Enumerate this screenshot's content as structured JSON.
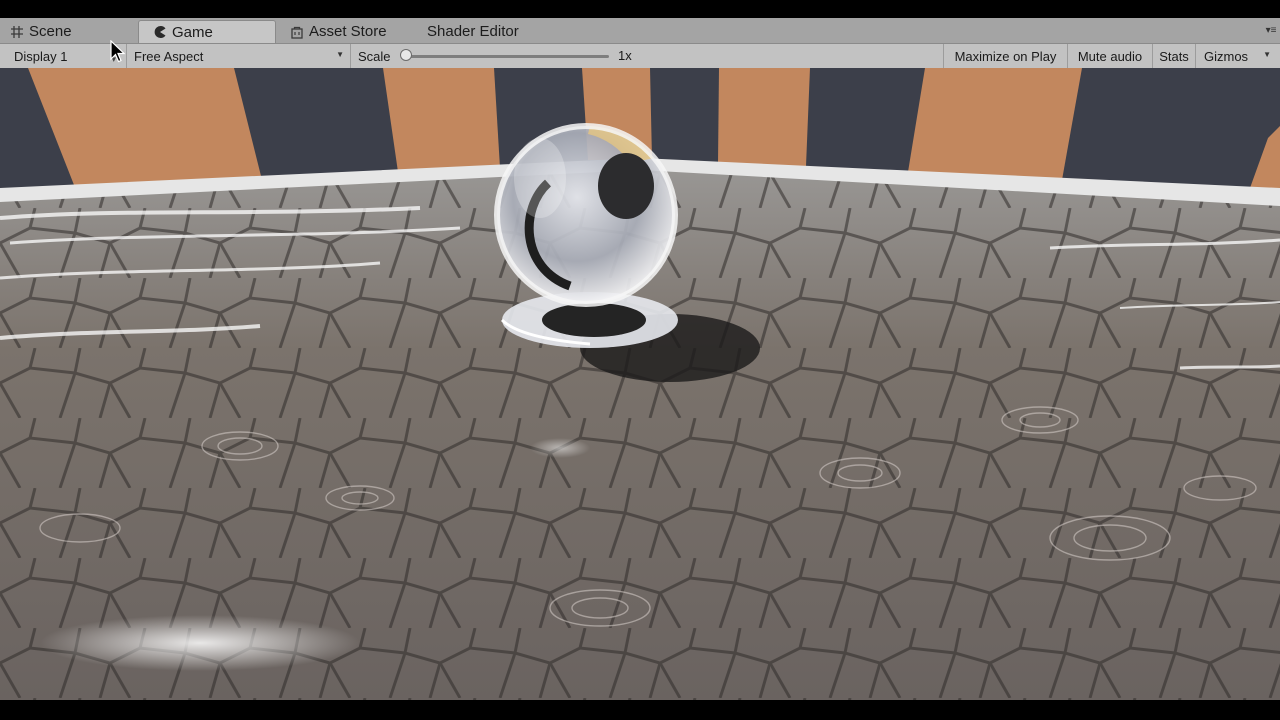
{
  "tabs": [
    {
      "label": "Scene",
      "icon": "grid-icon",
      "active": false
    },
    {
      "label": "Game",
      "icon": "pacman-icon",
      "active": true
    },
    {
      "label": "Asset Store",
      "icon": "store-icon",
      "active": false
    },
    {
      "label": "Shader Editor",
      "icon": "",
      "active": false
    }
  ],
  "toolbar": {
    "display": "Display 1",
    "aspect": "Free Aspect",
    "scale_label": "Scale",
    "scale_value": "1x",
    "scale_fraction": 0.0,
    "maximize": "Maximize on Play",
    "mute": "Mute audio",
    "stats": "Stats",
    "gizmos": "Gizmos"
  },
  "colors": {
    "wall_stripe_orange": "#c2875e",
    "wall_stripe_dark": "#3c3f4a",
    "floor_stone": "#6e6864",
    "floor_border": "#e8e8e8"
  }
}
